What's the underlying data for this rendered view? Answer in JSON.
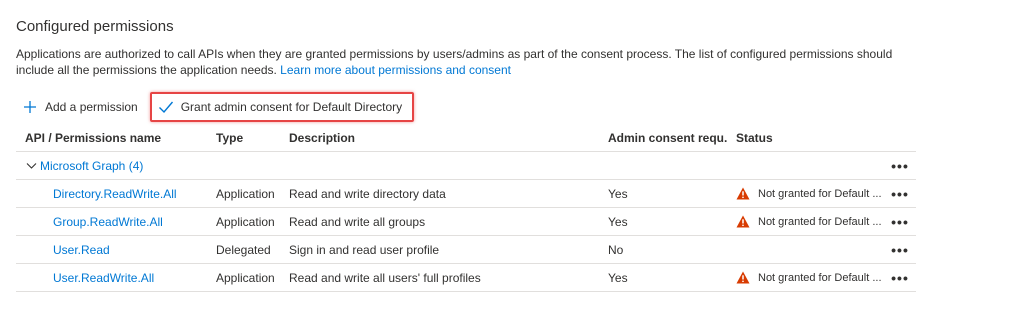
{
  "section": {
    "title": "Configured permissions",
    "description": "Applications are authorized to call APIs when they are granted permissions by users/admins as part of the consent process. The list of configured permissions should include all the permissions the application needs.",
    "learn_more_link": "Learn more about permissions and consent"
  },
  "toolbar": {
    "add_permission_label": "Add a permission",
    "grant_consent_label": "Grant admin consent for Default Directory"
  },
  "table": {
    "headers": {
      "api": "API / Permissions name",
      "type": "Type",
      "description": "Description",
      "admin_consent": "Admin consent requ...",
      "status": "Status"
    },
    "group": {
      "label": "Microsoft Graph (4)",
      "more": "•••"
    },
    "rows": [
      {
        "name": "Directory.ReadWrite.All",
        "type": "Application",
        "description": "Read and write directory data",
        "admin": "Yes",
        "status": "Not granted for Default ...",
        "warning": true,
        "more": "•••"
      },
      {
        "name": "Group.ReadWrite.All",
        "type": "Application",
        "description": "Read and write all groups",
        "admin": "Yes",
        "status": "Not granted for Default ...",
        "warning": true,
        "more": "•••"
      },
      {
        "name": "User.Read",
        "type": "Delegated",
        "description": "Sign in and read user profile",
        "admin": "No",
        "status": "",
        "warning": false,
        "more": "•••"
      },
      {
        "name": "User.ReadWrite.All",
        "type": "Application",
        "description": "Read and write all users' full profiles",
        "admin": "Yes",
        "status": "Not granted for Default ...",
        "warning": true,
        "more": "•••"
      }
    ]
  },
  "colors": {
    "link": "#0078d4",
    "highlight_border": "#e64545",
    "warning": "#d83b01",
    "divider": "#e1dfdd"
  },
  "icons": {
    "add": "plus-icon",
    "grant": "checkmark-icon",
    "group_toggle": "chevron-down-icon",
    "status": "warning-icon",
    "row_menu": "more-ellipsis-icon"
  }
}
